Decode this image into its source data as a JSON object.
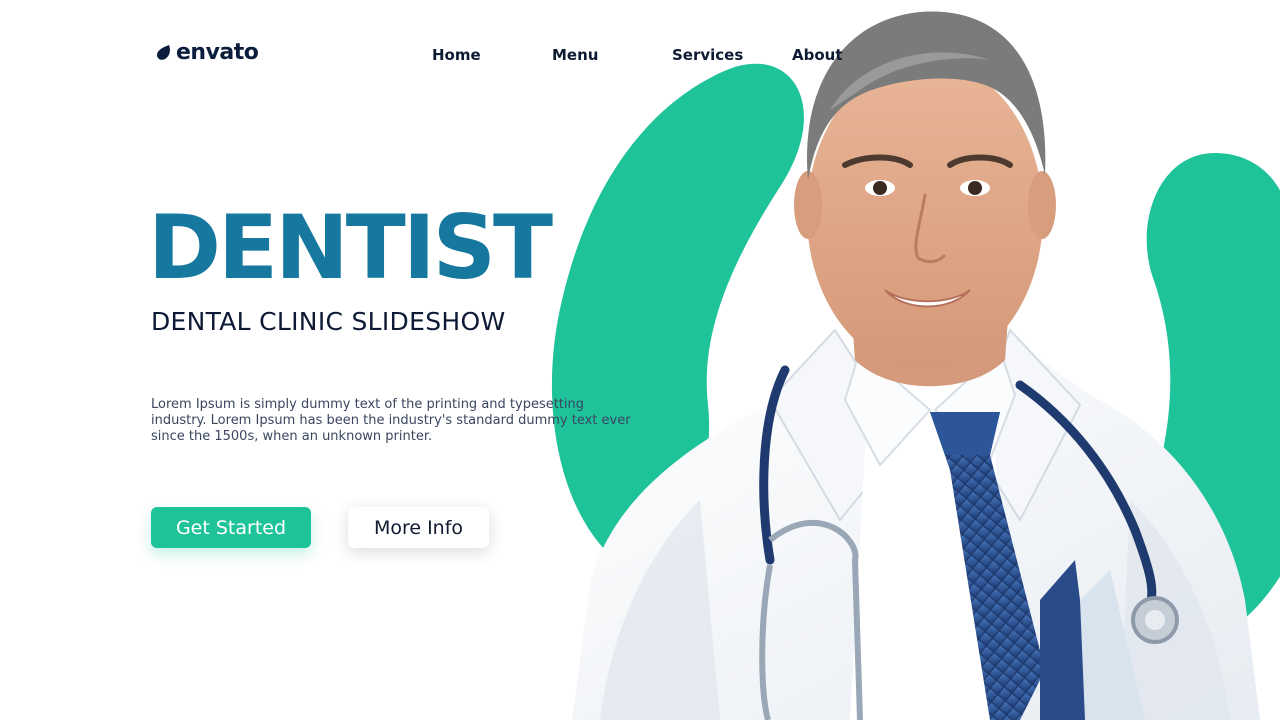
{
  "brand": {
    "logo_text": "envato",
    "logo_icon": "leaf-icon"
  },
  "nav": {
    "items": [
      {
        "label": "Home"
      },
      {
        "label": "Menu"
      },
      {
        "label": "Services"
      },
      {
        "label": "About"
      }
    ]
  },
  "hero": {
    "title": "DENTIST",
    "subtitle": "DENTAL CLINIC SLIDESHOW",
    "body": "Lorem Ipsum is simply dummy text of the printing and typesetting industry. Lorem Ipsum has been the industry's standard dummy text ever since the 1500s, when an unknown printer.",
    "buttons": {
      "primary_label": "Get Started",
      "secondary_label": "More Info"
    }
  },
  "colors": {
    "accent_teal": "#1ec39a",
    "title_blue": "#16789f",
    "text_dark": "#0d1b33",
    "background": "#ffffff"
  }
}
